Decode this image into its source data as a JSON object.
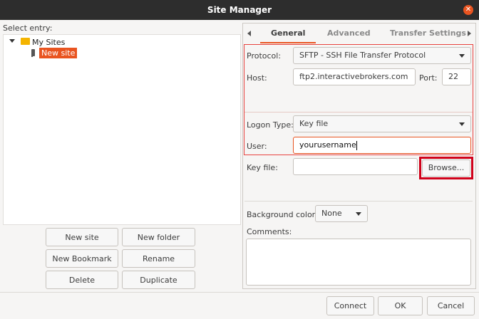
{
  "window": {
    "title": "Site Manager"
  },
  "left": {
    "select_entry_label": "Select entry:",
    "tree": {
      "root_label": "My Sites",
      "child_label": "New site"
    },
    "buttons": {
      "new_site": "New site",
      "new_folder": "New folder",
      "new_bookmark": "New Bookmark",
      "rename": "Rename",
      "delete": "Delete",
      "duplicate": "Duplicate"
    }
  },
  "tabs": [
    {
      "label": "General",
      "active": true
    },
    {
      "label": "Advanced",
      "active": false
    },
    {
      "label": "Transfer Settings",
      "active": false
    }
  ],
  "general": {
    "protocol_label": "Protocol:",
    "protocol_value": "SFTP - SSH File Transfer Protocol",
    "host_label": "Host:",
    "host_value": "ftp2.interactivebrokers.com",
    "port_label": "Port:",
    "port_value": "22",
    "logon_type_label": "Logon Type:",
    "logon_type_value": "Key file",
    "user_label": "User:",
    "user_value": "yourusername",
    "key_file_label": "Key file:",
    "key_file_value": "",
    "browse_button": "Browse...",
    "background_color_label": "Background color:",
    "background_color_value": "None",
    "comments_label": "Comments:",
    "comments_value": ""
  },
  "footer": {
    "connect": "Connect",
    "ok": "OK",
    "cancel": "Cancel"
  },
  "colors": {
    "accent": "#e95420",
    "highlight_red": "#e8423f",
    "annotation_red": "#d0021b"
  }
}
